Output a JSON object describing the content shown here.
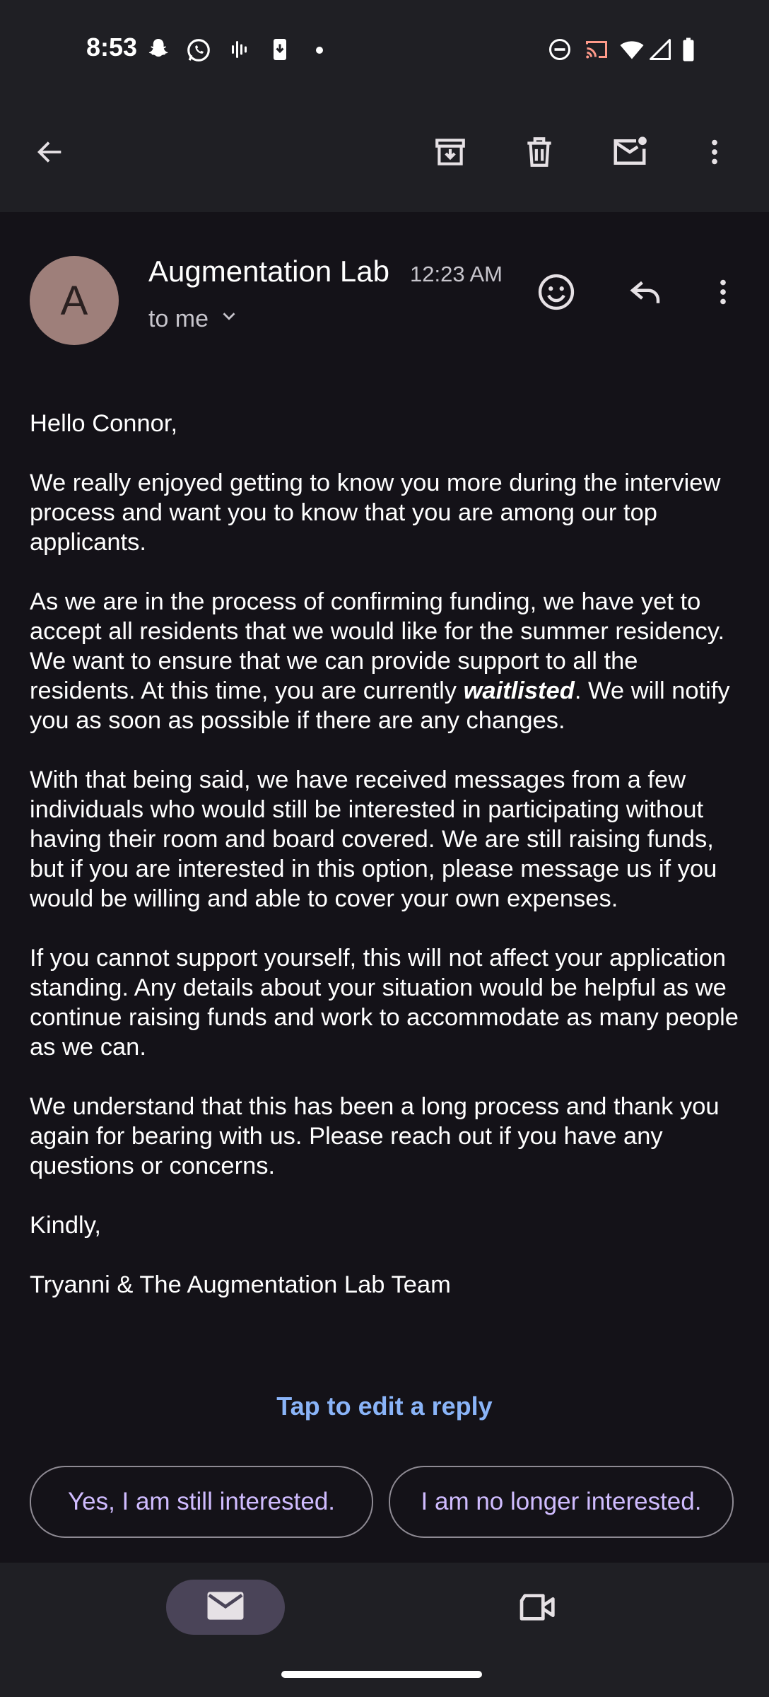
{
  "status_bar": {
    "time": "8:53",
    "left_icons": [
      "snapchat-icon",
      "whatsapp-icon",
      "voicemail-icon",
      "download-icon",
      "dot-icon"
    ],
    "right_icons": [
      "do-not-disturb-icon",
      "cast-icon",
      "wifi-icon",
      "signal-icon",
      "battery-icon"
    ]
  },
  "toolbar": {
    "icons": [
      "back-arrow-icon",
      "archive-icon",
      "delete-icon",
      "mark-unread-icon",
      "more-vert-icon"
    ]
  },
  "email": {
    "sender_initial": "A",
    "sender_name": "Augmentation Lab",
    "time": "12:23 AM",
    "recipient": "to me",
    "greeting": "Hello Connor,",
    "p1": "We really enjoyed getting to know you more during the interview process and want you to know that you are among our top applicants.",
    "p2_before": "As we are in the process of confirming funding, we have yet to accept all residents that we would like for the summer residency. We want to ensure that we can provide support to all the residents. At this time, you are currently ",
    "p2_emphasis": "waitlisted",
    "p2_after": ". We will notify you as soon as possible if there are any changes.",
    "p3": "With that being said, we have received messages from a few individuals who would still be interested in participating without having their room and board covered. We are still raising funds, but if you are interested in this option, please message us if you would be willing and able to cover your own expenses.",
    "p4": "If you cannot support yourself, this will not affect your application standing. Any details about your situation would be helpful as we continue raising funds and work to accommodate as many people as we can.",
    "p5": "We understand that this has been a long process and thank you again for bearing with us. Please reach out if you have any questions or concerns.",
    "signoff": "Kindly,",
    "signature": "Tryanni & The Augmentation Lab Team"
  },
  "reply": {
    "tap_to_edit": "Tap to edit a reply",
    "suggestions": [
      "Yes, I am still interested.",
      "I am no longer interested."
    ]
  },
  "bottom_nav": {
    "items": [
      "mail-icon",
      "video-icon"
    ]
  },
  "colors": {
    "background": "#141218",
    "bar": "#1f1f24",
    "accent_link": "#8ab4f8",
    "chip_text": "#d0bcff",
    "avatar": "#9e7f7a"
  }
}
